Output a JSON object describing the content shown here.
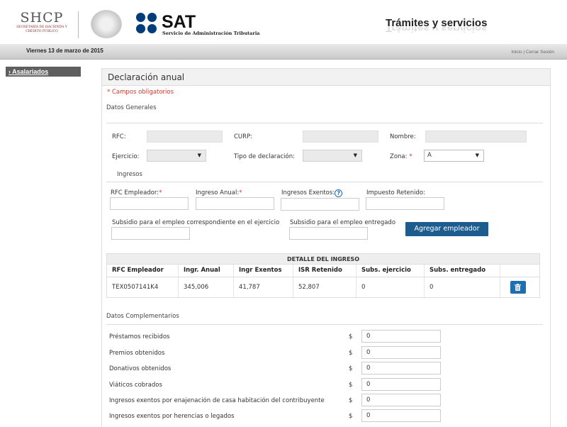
{
  "header": {
    "shcp_logo": "SHCP",
    "shcp_sub": "SECRETARÍA DE HACIENDA Y CRÉDITO PÚBLICO",
    "sat_logo": "SAT",
    "sat_sub": "Servicio de Administración Tributaria",
    "title": "Trámites y servicios"
  },
  "datebar": {
    "date": "Viernes 13 de marzo de 2015",
    "inicio": "Inicio",
    "separator": " | ",
    "cerrar": "Cerrar Sesión"
  },
  "sidebar": {
    "items": [
      {
        "label": "Asalariados",
        "arrow": "›"
      }
    ]
  },
  "form": {
    "title": "Declaración anual",
    "required_note": "* Campos obligatorios",
    "datos_generales": "Datos Generales",
    "rfc_label": "RFC:",
    "curp_label": "CURP:",
    "nombre_label": "Nombre:",
    "ejercicio_label": "Ejercicio:",
    "tipo_label": "Tipo de declaración:",
    "zona_label": "Zona:",
    "zona_value": "A",
    "ingresos_section": "Ingresos",
    "rfc_empleador_label": "RFC Empleador:",
    "ingreso_anual_label": "Ingreso Anual:",
    "ingresos_exentos_label": "Ingresos Exentos:",
    "impuesto_retenido_label": "Impuesto Retenido:",
    "subsidio_ejercicio_label": "Subsidio para el empleo correspondiente en el ejercicio",
    "subsidio_entregado_label": "Subsidio para el empleo entregado",
    "agregar_button": "Agregar empleador",
    "asterisk": "*",
    "help_glyph": "?",
    "dropdown_arrow": "▼"
  },
  "detalle": {
    "caption": "DETALLE DEL INGRESO",
    "columns": [
      "RFC Empleador",
      "Ingr. Anual",
      "Ingr Exentos",
      "ISR Retenido",
      "Subs. ejercicio",
      "Subs. entregado",
      ""
    ],
    "rows": [
      [
        "TEX0507141K4",
        "345,006",
        "41,787",
        "52,807",
        "0",
        "0"
      ]
    ]
  },
  "complementarios": {
    "title": "Datos Complementarios",
    "currency": "$",
    "items": [
      {
        "label": "Préstamos recibidos",
        "value": "0"
      },
      {
        "label": "Premios obtenidos",
        "value": "0"
      },
      {
        "label": "Donativos obtenidos",
        "value": "0"
      },
      {
        "label": "Viáticos cobrados",
        "value": "0"
      },
      {
        "label": "Ingresos exentos por enajenación de casa habitación del contribuyente",
        "value": "0"
      },
      {
        "label": "Ingresos exentos por herencias o legados",
        "value": "0"
      }
    ]
  },
  "colors": {
    "primary_button": "#1f5c8e",
    "required": "#d9352b",
    "sat_blue": "#003b7a",
    "trash_button": "#1f6fb0"
  },
  "icons": [
    "shcp-logo",
    "mexico-seal",
    "sat-logo",
    "help-icon",
    "chevron-down-icon",
    "trash-icon",
    "arrow-right-icon"
  ]
}
